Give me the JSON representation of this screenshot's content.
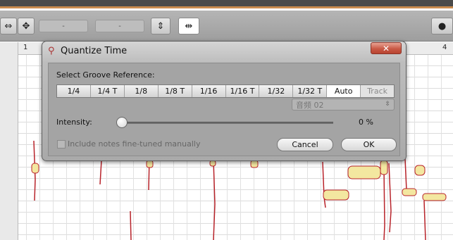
{
  "ruler": {
    "marks": [
      "1",
      "4"
    ]
  },
  "toolbar": {
    "field1": "-",
    "field2": "-"
  },
  "dialog": {
    "title": "Quantize Time",
    "close": "✕",
    "groove_label": "Select Groove Reference:",
    "groove_options": [
      "1/4",
      "1/4 T",
      "1/8",
      "1/8 T",
      "1/16",
      "1/16 T",
      "1/32",
      "1/32 T",
      "Auto",
      "Track"
    ],
    "selected_option": "Auto",
    "disabled_option": "Track",
    "track_select": "音频 02",
    "intensity_label": "Intensity:",
    "intensity_value": "0 %",
    "intensity_fraction": 0,
    "checkbox_label": "Include notes fine-tuned manually",
    "checkbox_checked": false,
    "cancel": "Cancel",
    "ok": "OK"
  },
  "colors": {
    "note_blob": "#f3e7a0",
    "note_edge": "#b8232a",
    "close_button": "#c95a46"
  }
}
